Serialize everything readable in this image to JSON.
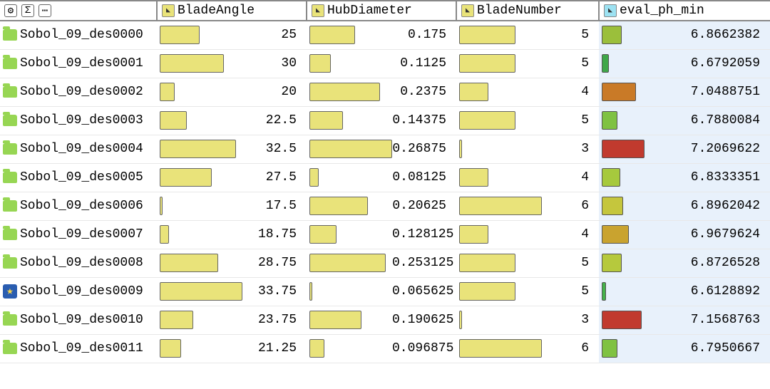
{
  "toolbar": {
    "gear": "⚙",
    "sigma": "Σ",
    "more": "⋯"
  },
  "columns": {
    "bladeAngle": {
      "label": "BladeAngle",
      "icon": "◣"
    },
    "hubDiameter": {
      "label": "HubDiameter",
      "icon": "◣"
    },
    "bladeNumber": {
      "label": "BladeNumber",
      "icon": "◣"
    },
    "evalPhMin": {
      "label": "eval_ph_min",
      "icon": "◣"
    }
  },
  "ranges": {
    "bladeAngle": {
      "min": 17.5,
      "max": 33.75
    },
    "hubDiameter": {
      "min": 0.065625,
      "max": 0.26875
    },
    "bladeNumber": {
      "min": 3,
      "max": 6
    },
    "evalPhMin": {
      "min": 6.6128892,
      "max": 7.2069622
    }
  },
  "rows": [
    {
      "name": "Sobol_09_des0000",
      "kind": "folder",
      "bladeAngle": 25,
      "hubDiameter": 0.175,
      "bladeNumber": 5,
      "eval": 6.8662382,
      "evalColor": "#9bbf3b",
      "evalW": 28
    },
    {
      "name": "Sobol_09_des0001",
      "kind": "folder",
      "bladeAngle": 30,
      "hubDiameter": 0.1125,
      "bladeNumber": 5,
      "eval": 6.6792059,
      "evalColor": "#3fa749",
      "evalW": 10
    },
    {
      "name": "Sobol_09_des0002",
      "kind": "folder",
      "bladeAngle": 20,
      "hubDiameter": 0.2375,
      "bladeNumber": 4,
      "eval": 7.0488751,
      "evalColor": "#c97a27",
      "evalW": 48
    },
    {
      "name": "Sobol_09_des0003",
      "kind": "folder",
      "bladeAngle": 22.5,
      "hubDiameter": 0.14375,
      "bladeNumber": 5,
      "eval": 6.7880084,
      "evalColor": "#7fc242",
      "evalW": 22
    },
    {
      "name": "Sobol_09_des0004",
      "kind": "folder",
      "bladeAngle": 32.5,
      "hubDiameter": 0.26875,
      "bladeNumber": 3,
      "eval": 7.2069622,
      "evalColor": "#c13a2e",
      "evalW": 60
    },
    {
      "name": "Sobol_09_des0005",
      "kind": "folder",
      "bladeAngle": 27.5,
      "hubDiameter": 0.08125,
      "bladeNumber": 4,
      "eval": 6.8333351,
      "evalColor": "#a6c93d",
      "evalW": 26
    },
    {
      "name": "Sobol_09_des0006",
      "kind": "folder",
      "bladeAngle": 17.5,
      "hubDiameter": 0.20625,
      "bladeNumber": 6,
      "eval": 6.8962042,
      "evalColor": "#c5c63d",
      "evalW": 30
    },
    {
      "name": "Sobol_09_des0007",
      "kind": "folder",
      "bladeAngle": 18.75,
      "hubDiameter": 0.128125,
      "bladeNumber": 4,
      "eval": 6.9679624,
      "evalColor": "#c9a32f",
      "evalW": 38
    },
    {
      "name": "Sobol_09_des0008",
      "kind": "folder",
      "bladeAngle": 28.75,
      "hubDiameter": 0.253125,
      "bladeNumber": 5,
      "eval": 6.8726528,
      "evalColor": "#b6c93d",
      "evalW": 28
    },
    {
      "name": "Sobol_09_des0009",
      "kind": "star",
      "bladeAngle": 33.75,
      "hubDiameter": 0.065625,
      "bladeNumber": 5,
      "eval": 6.6128892,
      "evalColor": "#45b24a",
      "evalW": 6
    },
    {
      "name": "Sobol_09_des0010",
      "kind": "folder",
      "bladeAngle": 23.75,
      "hubDiameter": 0.190625,
      "bladeNumber": 3,
      "eval": 7.1568763,
      "evalColor": "#c13a2e",
      "evalW": 56
    },
    {
      "name": "Sobol_09_des0011",
      "kind": "folder",
      "bladeAngle": 21.25,
      "hubDiameter": 0.096875,
      "bladeNumber": 6,
      "eval": 6.7950667,
      "evalColor": "#7fc242",
      "evalW": 22
    }
  ]
}
